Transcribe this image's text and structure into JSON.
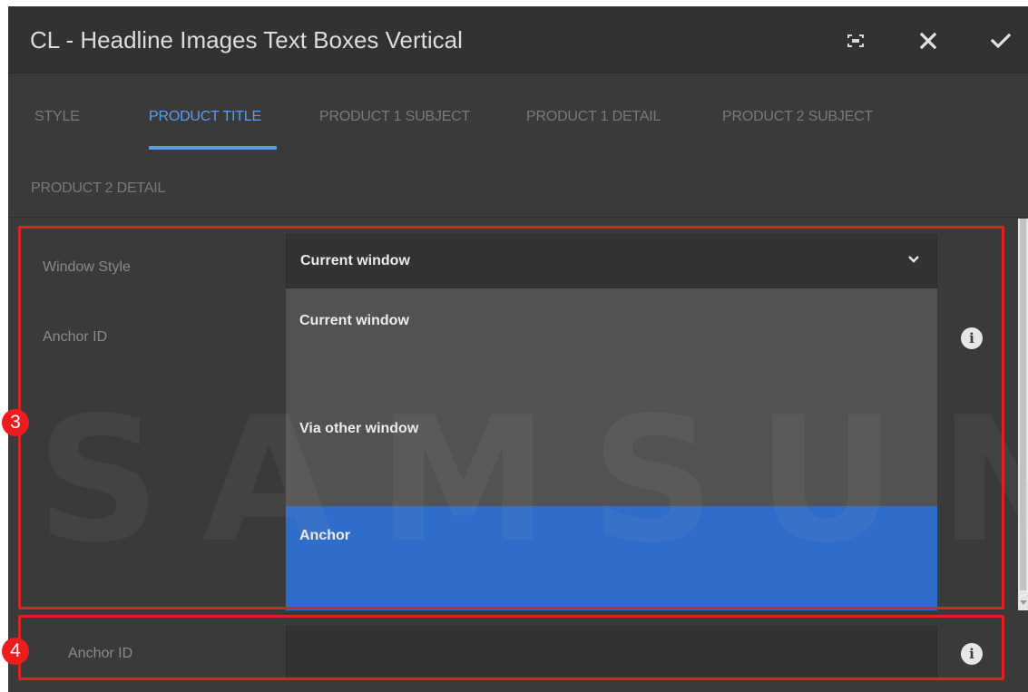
{
  "dialog": {
    "title": "CL - Headline Images Text Boxes Vertical",
    "buttons": {
      "fullscreen_icon": "fullscreen-icon",
      "close_icon": "close-icon",
      "done_icon": "checkmark-icon"
    }
  },
  "tabs": [
    {
      "label": "STYLE",
      "active": false
    },
    {
      "label": "PRODUCT TITLE",
      "active": true
    },
    {
      "label": "PRODUCT 1 SUBJECT",
      "active": false
    },
    {
      "label": "PRODUCT 1 DETAIL",
      "active": false
    },
    {
      "label": "PRODUCT 2 SUBJECT",
      "active": false
    },
    {
      "label": "PRODUCT 2 DETAIL",
      "active": false
    }
  ],
  "form": {
    "window_style_label": "Window Style",
    "window_style_value": "Current window",
    "window_style_options": [
      {
        "label": "Current window",
        "selected": false
      },
      {
        "label": "Via other window",
        "selected": false
      },
      {
        "label": "Anchor",
        "selected": true
      }
    ],
    "anchor_id_label_behind": "Anchor ID",
    "anchor_id_label": "Anchor ID",
    "anchor_id_value": ""
  },
  "annotations": [
    {
      "number": "3",
      "color": "#e02020"
    },
    {
      "number": "4",
      "color": "#e02020"
    }
  ],
  "watermark": "SAMSUNG",
  "colors": {
    "accent": "#5b9cf0",
    "selected_option": "#2f6dca",
    "annotation": "#e02020"
  }
}
